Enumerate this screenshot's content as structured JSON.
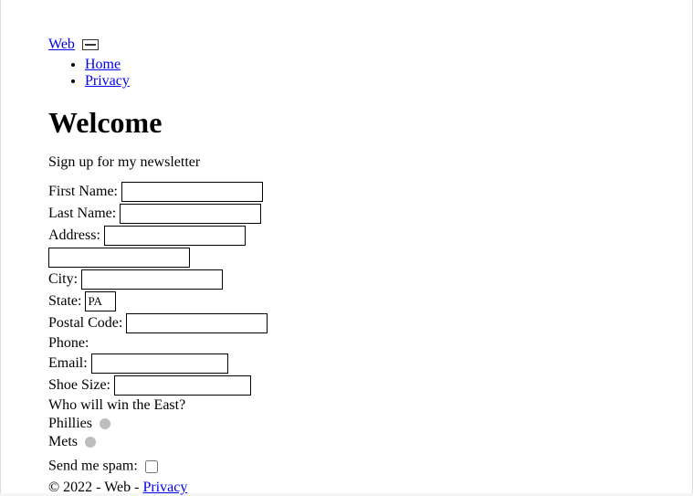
{
  "brand": {
    "label": "Web"
  },
  "nav": {
    "items": [
      {
        "label": "Home"
      },
      {
        "label": "Privacy"
      }
    ]
  },
  "page": {
    "title": "Welcome",
    "subtitle": "Sign up for my newsletter"
  },
  "form": {
    "first_name": {
      "label": "First Name:",
      "value": ""
    },
    "last_name": {
      "label": "Last Name:",
      "value": ""
    },
    "address1": {
      "label": "Address:",
      "value": ""
    },
    "address2": {
      "value": ""
    },
    "city": {
      "label": "City:",
      "value": ""
    },
    "state": {
      "label": "State:",
      "value": "PA"
    },
    "postal_code": {
      "label": "Postal Code:",
      "value": ""
    },
    "phone": {
      "label": "Phone:"
    },
    "email": {
      "label": "Email:",
      "value": ""
    },
    "shoe_size": {
      "label": "Shoe Size:",
      "value": ""
    },
    "poll": {
      "question": "Who will win the East?",
      "options": [
        {
          "label": "Phillies"
        },
        {
          "label": "Mets"
        }
      ]
    },
    "spam": {
      "label": "Send me spam:"
    }
  },
  "footer": {
    "copyright": "© 2022 - Web - ",
    "privacy_label": "Privacy"
  }
}
